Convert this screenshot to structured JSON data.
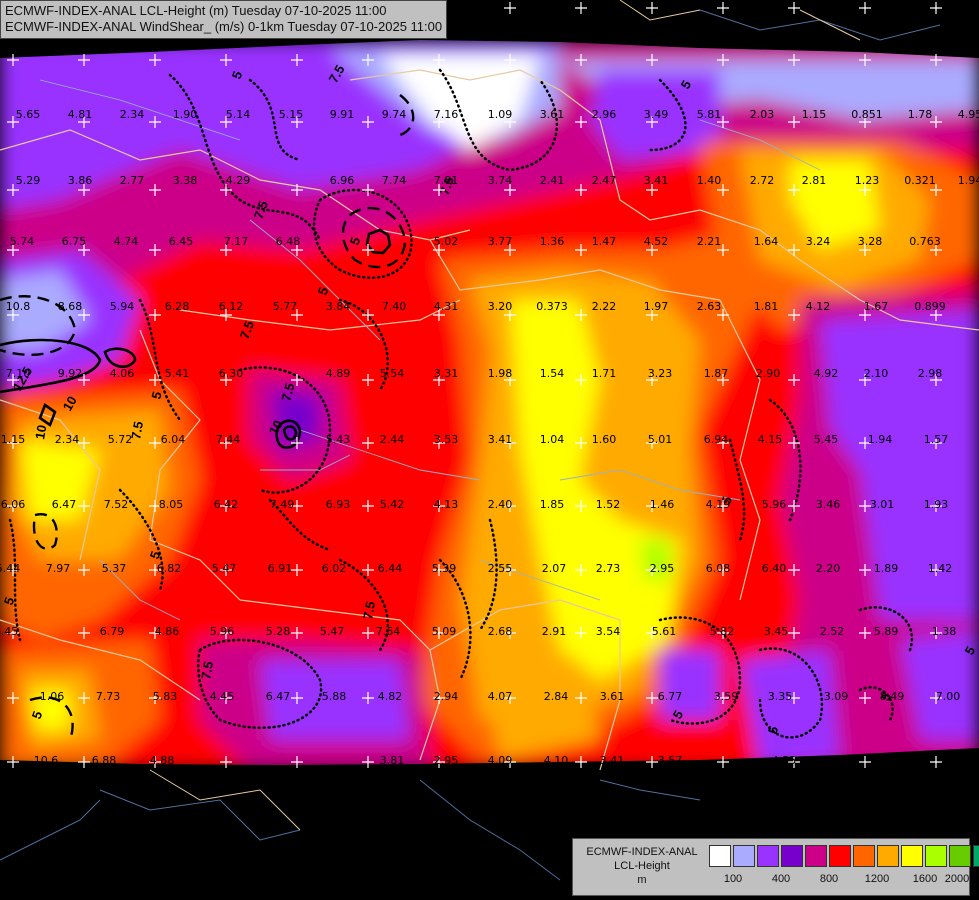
{
  "header": {
    "line1": "ECMWF-INDEX-ANAL LCL-Height (m) Tuesday 07-10-2025 11:00",
    "line2": "ECMWF-INDEX-ANAL WindShear_ (m/s) 0-1km Tuesday 07-10-2025 11:00"
  },
  "legend": {
    "line1": "ECMWF-INDEX-ANAL",
    "line2": "LCL-Height",
    "line3": "m",
    "colors": [
      "#ffffff",
      "#aaaaff",
      "#9933ff",
      "#7700cc",
      "#cc0088",
      "#ff0000",
      "#ff6600",
      "#ffaa00",
      "#ffff00",
      "#aaff00",
      "#66cc00",
      "#00aa66",
      "#00bbee"
    ],
    "ticks": [
      "100",
      "400",
      "800",
      "1200",
      "1600",
      "2000"
    ]
  },
  "contour_labels": [
    "7.5",
    "5",
    "7.5",
    "5",
    "7.5",
    "5",
    "10",
    "12.5",
    "10",
    "5",
    "7.5",
    "5",
    "5",
    "7.5",
    "7.5",
    "5",
    "5",
    "5",
    "5",
    "7.5",
    "10",
    "5",
    "5",
    "7.5",
    "5"
  ],
  "values": [
    {
      "t": "5.65"
    },
    {
      "t": "4.81"
    },
    {
      "t": "2.34"
    },
    {
      "t": "1.90"
    },
    {
      "t": "5.14"
    },
    {
      "t": "5.15"
    },
    {
      "t": "9.91"
    },
    {
      "t": "9.74"
    },
    {
      "t": "7.16"
    },
    {
      "t": "1.09"
    },
    {
      "t": "3.61"
    },
    {
      "t": "2.96"
    },
    {
      "t": "3.49"
    },
    {
      "t": "5.81"
    },
    {
      "t": "2.03"
    },
    {
      "t": "1.15"
    },
    {
      "t": "0.851"
    },
    {
      "t": "1.78"
    },
    {
      "t": "4.95"
    },
    {
      "t": "5.29"
    },
    {
      "t": "3.86"
    },
    {
      "t": "2.77"
    },
    {
      "t": "3.38"
    },
    {
      "t": "4.29"
    },
    {
      "t": "6.96"
    },
    {
      "t": "7.74"
    },
    {
      "t": "7.81"
    },
    {
      "t": "3.74"
    },
    {
      "t": "2.41"
    },
    {
      "t": "2.47"
    },
    {
      "t": "3.41"
    },
    {
      "t": "1.40"
    },
    {
      "t": "2.72"
    },
    {
      "t": "2.81"
    },
    {
      "t": "1.23"
    },
    {
      "t": "0.321"
    },
    {
      "t": "1.94"
    },
    {
      "t": "5.74"
    },
    {
      "t": "6.75"
    },
    {
      "t": "4.74"
    },
    {
      "t": "6.45"
    },
    {
      "t": "7.17"
    },
    {
      "t": "6.48"
    },
    {
      "t": "5.02"
    },
    {
      "t": "3.77"
    },
    {
      "t": "1.36"
    },
    {
      "t": "1.47"
    },
    {
      "t": "4.52"
    },
    {
      "t": "2.21"
    },
    {
      "t": "1.64"
    },
    {
      "t": "3.24"
    },
    {
      "t": "3.28"
    },
    {
      "t": "0.763"
    },
    {
      "t": "10.8"
    },
    {
      "t": "8.68"
    },
    {
      "t": "5.94"
    },
    {
      "t": "6.28"
    },
    {
      "t": "6.12"
    },
    {
      "t": "5.77"
    },
    {
      "t": "3.84"
    },
    {
      "t": "7.40"
    },
    {
      "t": "4.31"
    },
    {
      "t": "3.20"
    },
    {
      "t": "0.373"
    },
    {
      "t": "2.22"
    },
    {
      "t": "1.97"
    },
    {
      "t": "2.63"
    },
    {
      "t": "1.81"
    },
    {
      "t": "4.12"
    },
    {
      "t": "1.67"
    },
    {
      "t": "0.899"
    },
    {
      "t": "7.10"
    },
    {
      "t": "9.92"
    },
    {
      "t": "4.06"
    },
    {
      "t": "5.41"
    },
    {
      "t": "6.30"
    },
    {
      "t": "4.89"
    },
    {
      "t": "5.54"
    },
    {
      "t": "3.31"
    },
    {
      "t": "1.98"
    },
    {
      "t": "1.54"
    },
    {
      "t": "1.71"
    },
    {
      "t": "3.23"
    },
    {
      "t": "1.87"
    },
    {
      "t": "2.90"
    },
    {
      "t": "4.92"
    },
    {
      "t": "2.10"
    },
    {
      "t": "2.98"
    },
    {
      "t": "1.15"
    },
    {
      "t": "2.34"
    },
    {
      "t": "5.72"
    },
    {
      "t": "6.04"
    },
    {
      "t": "7.44"
    },
    {
      "t": "5.43"
    },
    {
      "t": "2.44"
    },
    {
      "t": "3.53"
    },
    {
      "t": "3.41"
    },
    {
      "t": "1.04"
    },
    {
      "t": "1.60"
    },
    {
      "t": "5.01"
    },
    {
      "t": "6.94"
    },
    {
      "t": "4.15"
    },
    {
      "t": "5.45"
    },
    {
      "t": "1.94"
    },
    {
      "t": "1.57"
    },
    {
      "t": "6.06"
    },
    {
      "t": "6.47"
    },
    {
      "t": "7.52"
    },
    {
      "t": "8.05"
    },
    {
      "t": "6.42"
    },
    {
      "t": "7.49"
    },
    {
      "t": "6.93"
    },
    {
      "t": "5.42"
    },
    {
      "t": "4.13"
    },
    {
      "t": "2.40"
    },
    {
      "t": "1.85"
    },
    {
      "t": "1.52"
    },
    {
      "t": "1.46"
    },
    {
      "t": "4.19"
    },
    {
      "t": "5.96"
    },
    {
      "t": "3.46"
    },
    {
      "t": "3.01"
    },
    {
      "t": "1.93"
    },
    {
      "t": "5.44"
    },
    {
      "t": "7.97"
    },
    {
      "t": "5.37"
    },
    {
      "t": "6.82"
    },
    {
      "t": "5.47"
    },
    {
      "t": "6.91"
    },
    {
      "t": "6.02"
    },
    {
      "t": "6.44"
    },
    {
      "t": "5.39"
    },
    {
      "t": "2.55"
    },
    {
      "t": "2.07"
    },
    {
      "t": "2.73"
    },
    {
      "t": "2.95"
    },
    {
      "t": "6.08"
    },
    {
      "t": "6.40"
    },
    {
      "t": "2.20"
    },
    {
      "t": "1.89"
    },
    {
      "t": "1.42"
    },
    {
      "t": "4.45"
    },
    {
      "t": "6.79"
    },
    {
      "t": "4.86"
    },
    {
      "t": "5.96"
    },
    {
      "t": "5.28"
    },
    {
      "t": "5.47"
    },
    {
      "t": "7.64"
    },
    {
      "t": "5.09"
    },
    {
      "t": "2.68"
    },
    {
      "t": "2.91"
    },
    {
      "t": "3.54"
    },
    {
      "t": "5.61"
    },
    {
      "t": "5.82"
    },
    {
      "t": "3.45"
    },
    {
      "t": "2.52"
    },
    {
      "t": "5.89"
    },
    {
      "t": "1.38"
    },
    {
      "t": "1.06"
    },
    {
      "t": "7.73"
    },
    {
      "t": "5.83"
    },
    {
      "t": "4.45"
    },
    {
      "t": "6.47"
    },
    {
      "t": "5.88"
    },
    {
      "t": "4.82"
    },
    {
      "t": "2.94"
    },
    {
      "t": "4.07"
    },
    {
      "t": "2.84"
    },
    {
      "t": "3.61"
    },
    {
      "t": "6.77"
    },
    {
      "t": "3.59"
    },
    {
      "t": "3.35"
    },
    {
      "t": "3.09"
    },
    {
      "t": "8.49"
    },
    {
      "t": "7.00"
    },
    {
      "t": "10.6"
    },
    {
      "t": "6.88"
    },
    {
      "t": "4.88"
    },
    {
      "t": "3.81"
    },
    {
      "t": "2.95"
    },
    {
      "t": "4.09"
    },
    {
      "t": "4.10"
    },
    {
      "t": "3.41"
    },
    {
      "t": "3.57"
    },
    {
      "t": "4.35"
    },
    {
      "t": "3.07"
    },
    {
      "t": "3.31"
    }
  ]
}
